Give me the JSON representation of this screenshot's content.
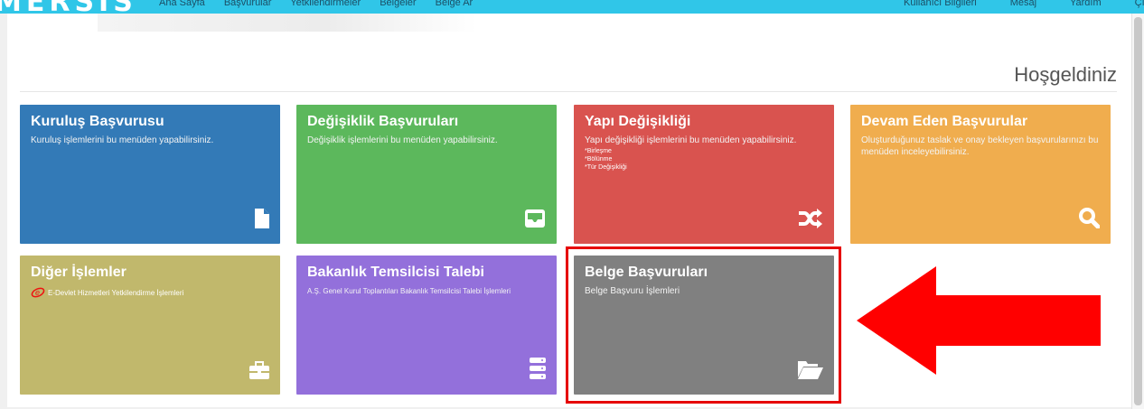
{
  "topbar": {
    "logo": "MERSIS",
    "nav": [
      "Ana Sayfa",
      "Başvurular",
      "Yetkilendirmeler",
      "Belgeler",
      "Belge Ar"
    ],
    "right": [
      "Kullanıcı Bilgileri",
      "Mesaj",
      "Yardım",
      "Çıkış"
    ]
  },
  "page": {
    "welcome": "Hoşgeldiniz"
  },
  "tiles": [
    {
      "title": "Kuruluş Başvurusu",
      "desc": "Kuruluş işlemlerini bu menüden yapabilirsiniz.",
      "color": "#337ab7",
      "icon": "file-icon"
    },
    {
      "title": "Değişiklik Başvuruları",
      "desc": "Değişiklik işlemlerini bu menüden yapabilirsiniz.",
      "color": "#5cb85c",
      "icon": "inbox-icon"
    },
    {
      "title": "Yapı Değişikliği",
      "desc": "Yapı değişikliği işlemlerini bu menüden yapabilirsiniz.",
      "items": [
        "*Birleşme",
        "*Bölünme",
        "*Tür Değişikliği"
      ],
      "color": "#d9534f",
      "icon": "shuffle-icon"
    },
    {
      "title": "Devam Eden Başvurular",
      "desc": "Oluşturduğunuz taslak ve onay bekleyen başvurularınızı bu menüden inceleyebilirsiniz.",
      "color": "#f0ad4e",
      "icon": "search-icon"
    },
    {
      "title": "Diğer İşlemler",
      "desc": "E-Devlet Hizmetleri Yetkilendirme İşlemleri",
      "color": "#c1b86c",
      "icon": "briefcase-icon"
    },
    {
      "title": "Bakanlık Temsilcisi Talebi",
      "desc": "A.Ş. Genel Kurul Toplantıları Bakanlık Temsilcisi Talebi İşlemleri",
      "color": "#9370db",
      "icon": "server-icon"
    },
    {
      "title": "Belge Başvuruları",
      "desc": "Belge Başvuru İşlemleri",
      "color": "#808080",
      "icon": "folder-open-icon"
    }
  ],
  "annotation": {
    "highlight_color": "#e60000",
    "arrow_color": "#ff0000",
    "highlighted_tile": "Belge Başvuruları"
  }
}
